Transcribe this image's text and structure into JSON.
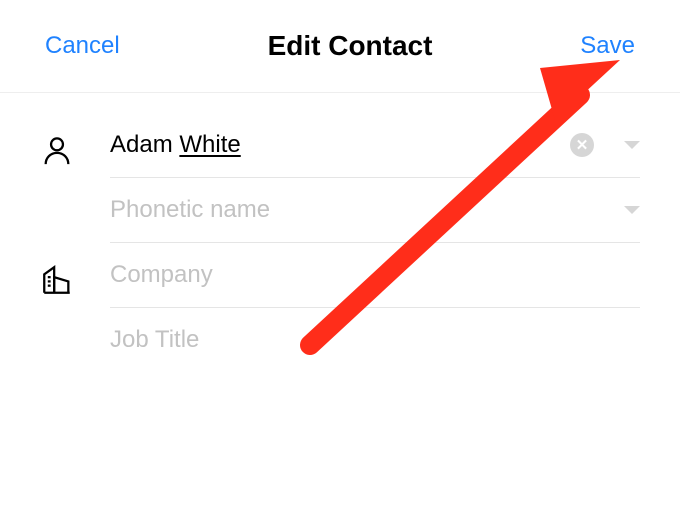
{
  "header": {
    "cancel_label": "Cancel",
    "title": "Edit Contact",
    "save_label": "Save"
  },
  "fields": {
    "name": {
      "first": "Adam",
      "last": "White",
      "clear_icon": "close-icon"
    },
    "phonetic_placeholder": "Phonetic name",
    "company_placeholder": "Company",
    "job_title_placeholder": "Job Title"
  },
  "icons": {
    "person": "person-icon",
    "company": "company-icon",
    "chevron": "chevron-down-icon",
    "clear": "close-icon"
  },
  "annotation": {
    "arrow_color": "#ff2d1a"
  }
}
